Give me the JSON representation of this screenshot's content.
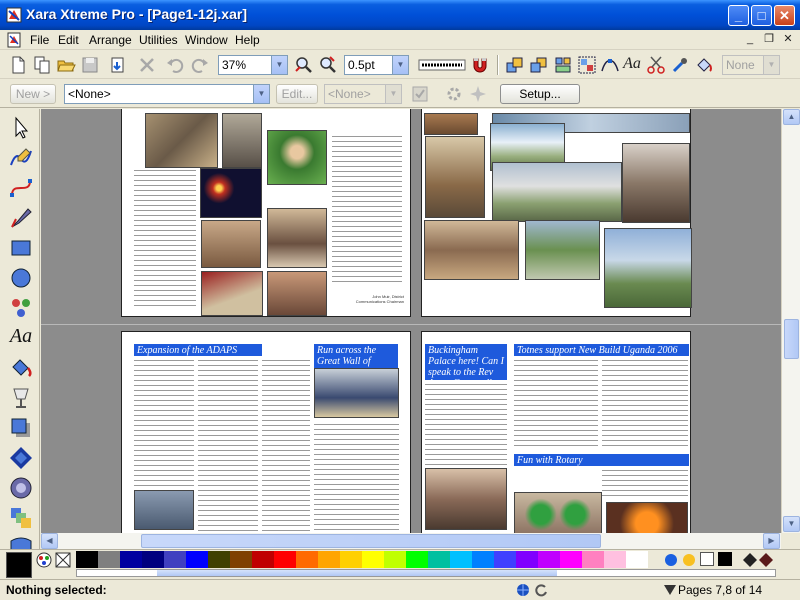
{
  "window": {
    "title": "Xara Xtreme Pro - [Page1-12j.xar]",
    "minimize": "_",
    "maximize": "□",
    "close": "✕"
  },
  "menu": {
    "items": [
      "File",
      "Edit",
      "Arrange",
      "Utilities",
      "Window",
      "Help"
    ],
    "mdi_minimize": "_",
    "mdi_restore": "❐",
    "mdi_close": "✕"
  },
  "toolbar": {
    "zoom_value": "37%",
    "line_width_value": "0.5pt",
    "blend_value": "None"
  },
  "infobar": {
    "new_label": "New >",
    "style_value": "<None>",
    "edit_label": "Edit...",
    "style2_value": "<None>",
    "setup_label": "Setup..."
  },
  "newsletter": {
    "page3_signature": "John Muir, District Communications Chairman",
    "headlines": {
      "adaps": "Expansion of the ADAPS Project",
      "great_wall": "Run across the Great Wall of China",
      "buckingham": "Buckingham Palace here! Can I speak to the Rev Amos Cresswell please?",
      "uganda": "Totnes support New Build Uganda 2006",
      "rotary": "Fun with Rotary"
    }
  },
  "palette": {
    "colors": [
      "#000000",
      "#7f7f7f",
      "#0000a0",
      "#00007f",
      "#4040c0",
      "#0000ff",
      "#404000",
      "#7f4000",
      "#c00000",
      "#ff0000",
      "#ff6a00",
      "#ffa500",
      "#ffd000",
      "#ffff00",
      "#c0ff00",
      "#00ff00",
      "#00c0a0",
      "#00c0ff",
      "#0080ff",
      "#4040ff",
      "#8000ff",
      "#c000ff",
      "#ff00ff",
      "#ff80c0",
      "#ffc0e0",
      "#ffffff"
    ]
  },
  "status": {
    "selection": "Nothing selected:",
    "pages": "Pages 7,8 of 14"
  }
}
